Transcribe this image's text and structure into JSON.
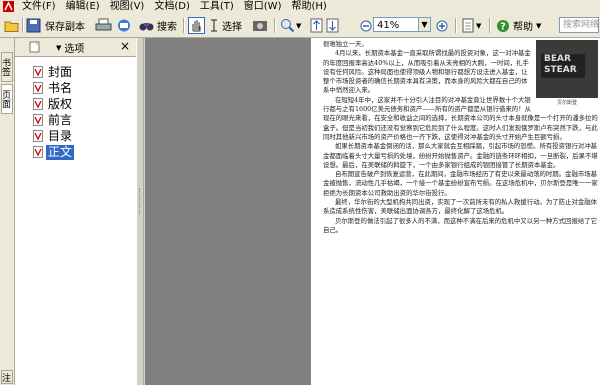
{
  "menu": {
    "items": [
      "文件(F)",
      "编辑(E)",
      "视图(V)",
      "文档(D)",
      "工具(T)",
      "窗口(W)",
      "帮助(H)"
    ]
  },
  "toolbar": {
    "save_copy": "保存副本",
    "search": "搜索",
    "select": "选择",
    "zoom": "41%",
    "help": "帮助",
    "search_placeholder": "搜索网络"
  },
  "left_tabs": [
    "书签",
    "页面",
    "注释"
  ],
  "nav": {
    "options": "选项",
    "close": "×",
    "items": [
      "封面",
      "书名",
      "版权",
      "前言",
      "目录",
      "正文"
    ],
    "selected_index": 5
  },
  "document": {
    "image_sign": "BEAR\nSTEAR",
    "image_caption": "贝尔斯登",
    "paragraphs": [
      "很难独立一天。",
      "4月以来，长期资本基金一直采取所谓找最的投资对象，这一对冲基金的年度回报率高达40%以上，从而吸引着从未亮相的大腕，一时间，扎手设有任何风险。这种局面也使得顶级人物和银行都想方设法进入基金，让整个市场投资者的确信长期资本具有决策，而本身的风险大都在自己的体系中悄然迎入来。",
      "在短短4年中，这家并不十分引人注目的对冲基金竟让世界数十个大银行都与之有1600亿美元债务和资产——所有的资产都是从银行借来的！从现在的眼光来看，在安全和收益之间的选择，长期资本公司的头寸本身就像是一个打开的潘多拉的盒子。但是当初我们还没有觉察到它危险到了什么程度。这时人们发现俄罗斯卢布突然下跌，与此同时其他新兴市场的资产价格也一齐下跌，这使得对冲基金的头寸开始产生巨额亏损。",
      "如果长期资本基金倒闭的话，那么大家就会互相踩踏，引起市场的恐慌。所有投资银行对冲基金都面临着头寸大量亏损的处境，纷纷开始抛售资产。金融的链条环环相扣，一旦断裂，后果不堪设想。最后，在美联储的斡旋下，一个由多家银行组成的银团接管了长期资本基金。",
      "自布朗宣告破产到恢复运营，在此期间，金融市场经历了有史以来最动荡的时期。金融市场基金被抛售，流动性几乎枯竭，一个接一个基金纷纷宣布亏损。在这场危机中，贝尔斯登是唯一一家拒绝为长期资本公司救助出资的华尔街投行。",
      "最终，华尔街的大型机构共同出资，实现了一次前所未有的私人救援行动。为了防止对金融体系造成系统性伤害，美联储出面协调各方，最终化解了这场危机。",
      "贝尔斯登的做法引起了很多人的不满，而这种不满在后来的危机中又以另一种方式回报给了它自己。"
    ]
  }
}
